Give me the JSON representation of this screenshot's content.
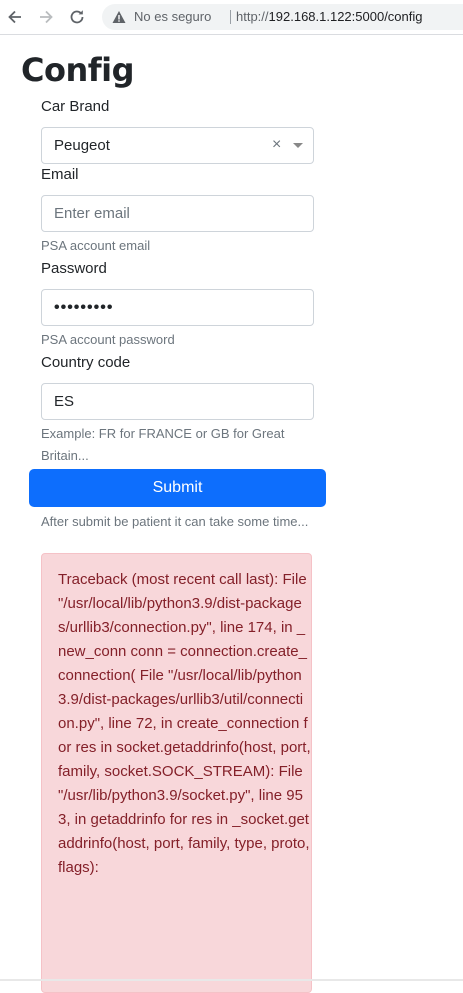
{
  "browser": {
    "security_text": "No es seguro",
    "url_scheme": "http://",
    "url_rest": "192.168.1.122:5000/config"
  },
  "page": {
    "title": "Config"
  },
  "form": {
    "car_brand": {
      "label": "Car Brand",
      "selected": "Peugeot"
    },
    "email": {
      "label": "Email",
      "placeholder": "Enter email",
      "help": "PSA account email"
    },
    "password": {
      "label": "Password",
      "value_masked": "•••••••••",
      "help": "PSA account password"
    },
    "country": {
      "label": "Country code",
      "value": "ES",
      "help": "Example: FR for FRANCE or GB for Great Britain..."
    },
    "submit_label": "Submit",
    "submit_help": "After submit be patient it can take some time..."
  },
  "error": {
    "message": "Traceback (most recent call last): File \"/usr/local/lib/python3.9/dist-packages/urllib3/connection.py\", line 174, in _new_conn conn = connection.create_connection( File \"/usr/local/lib/python3.9/dist-packages/urllib3/util/connection.py\", line 72, in create_connection for res in socket.getaddrinfo(host, port, family, socket.SOCK_STREAM): File \"/usr/lib/python3.9/socket.py\", line 953, in getaddrinfo for res in _socket.getaddrinfo(host, port, family, type, proto, flags):"
  },
  "colors": {
    "primary": "#0d6efd",
    "danger_bg": "#f8d7da",
    "danger_text": "#842029"
  }
}
